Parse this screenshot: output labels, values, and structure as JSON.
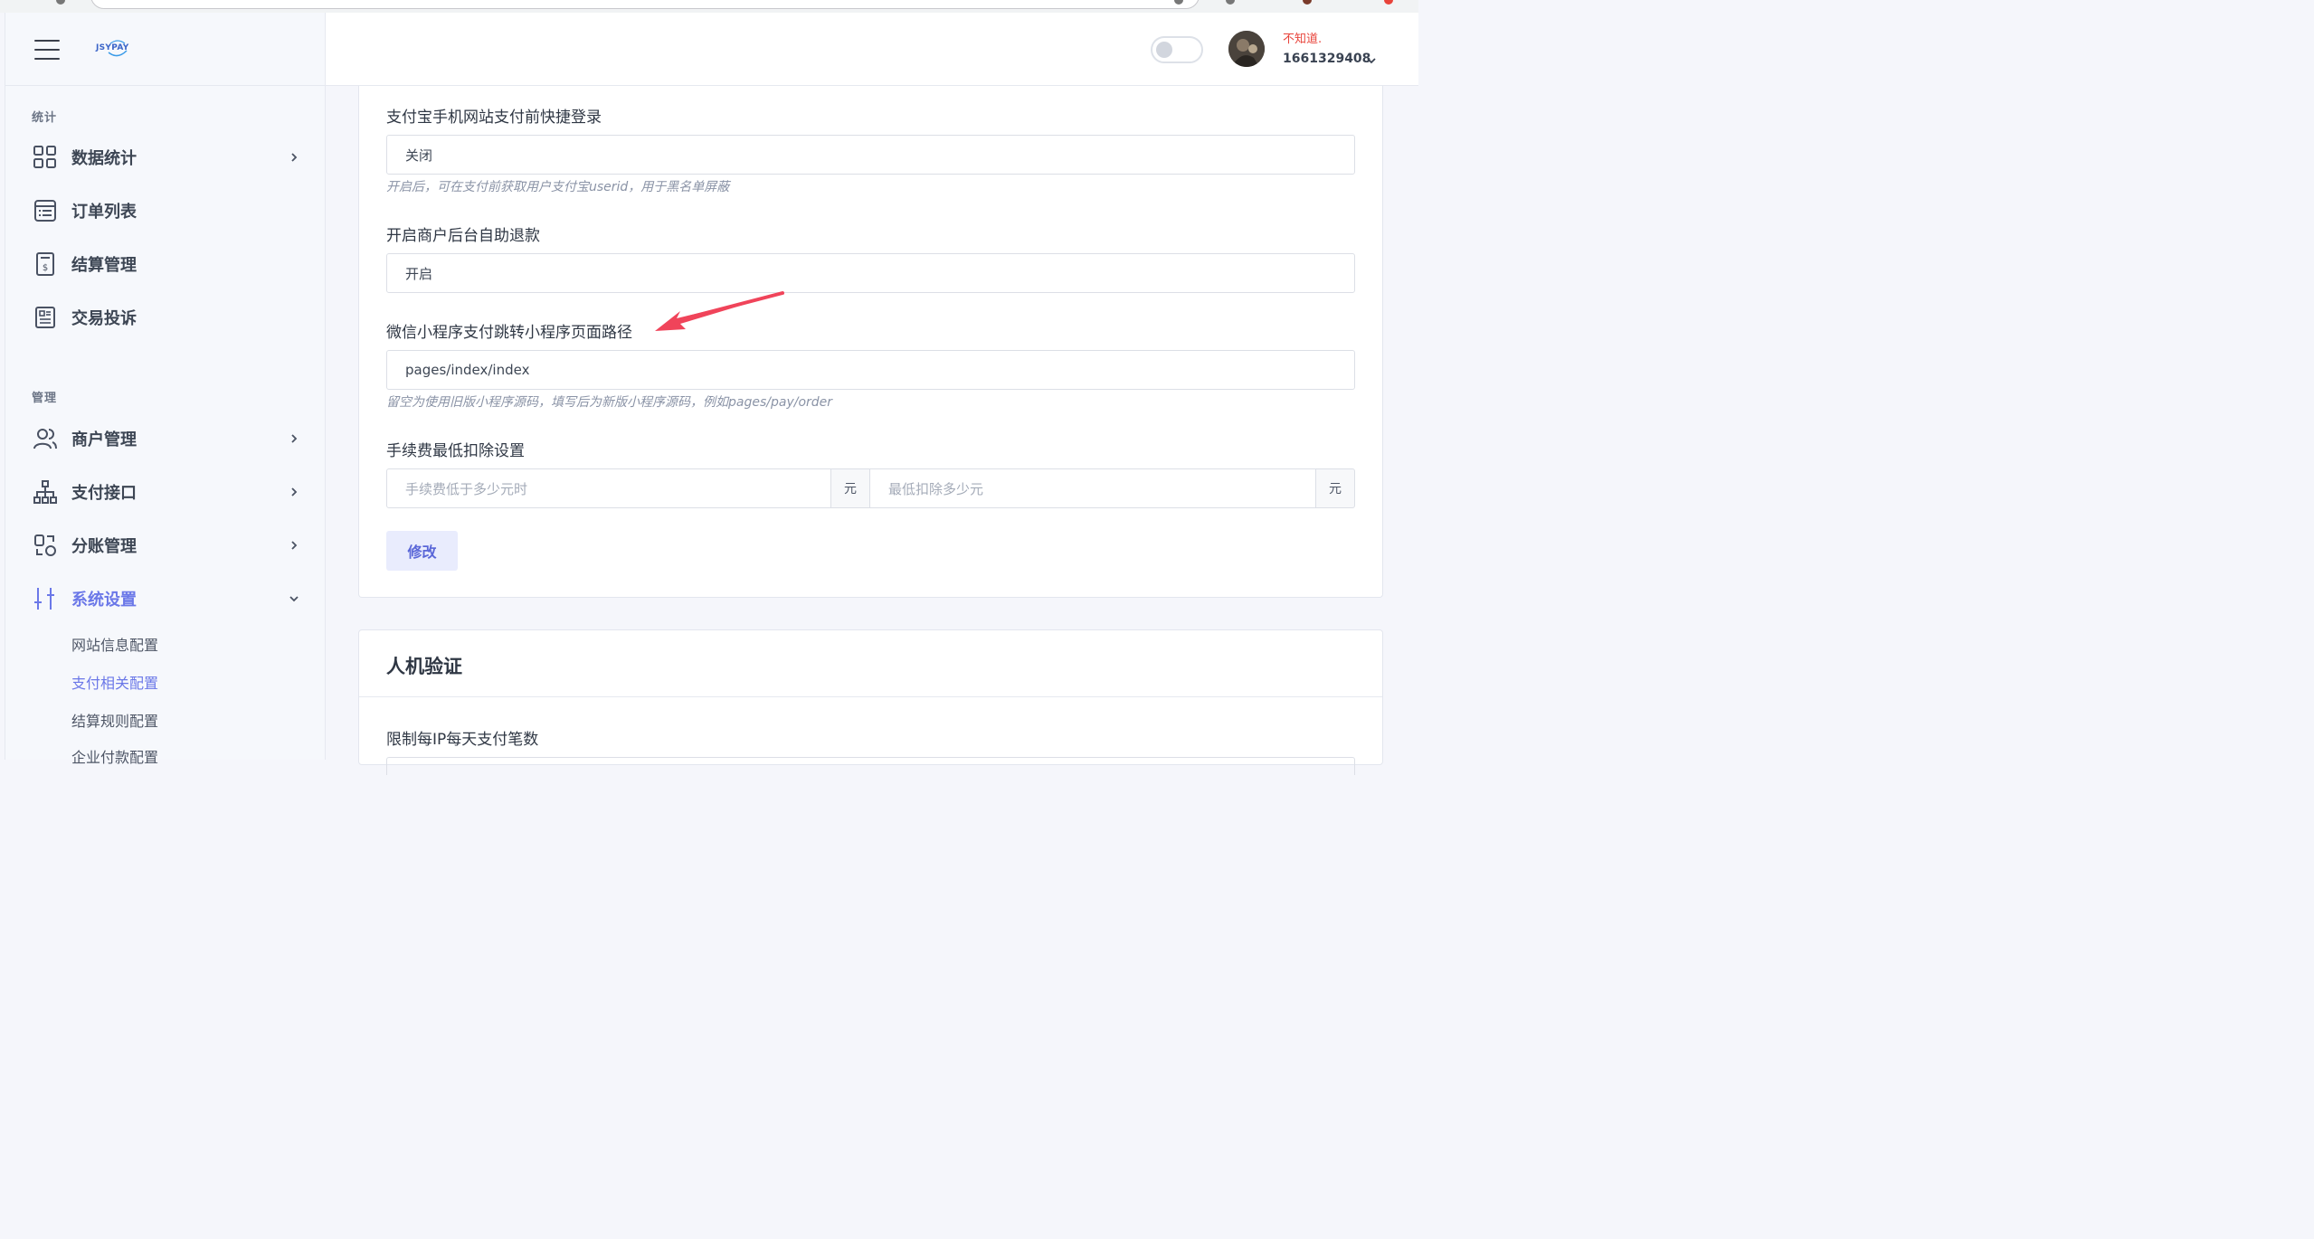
{
  "app": {
    "logo": "JSYPAY"
  },
  "sidebar": {
    "sections": [
      {
        "label": "统计"
      },
      {
        "label": "管理"
      }
    ],
    "items": [
      {
        "label": "数据统计",
        "icon": "grid-icon",
        "has_children": true
      },
      {
        "label": "订单列表",
        "icon": "list-icon",
        "has_children": false
      },
      {
        "label": "结算管理",
        "icon": "document-dollar-icon",
        "has_children": false
      },
      {
        "label": "交易投诉",
        "icon": "newspaper-icon",
        "has_children": false
      },
      {
        "label": "商户管理",
        "icon": "users-icon",
        "has_children": true
      },
      {
        "label": "支付接口",
        "icon": "sitemap-icon",
        "has_children": true
      },
      {
        "label": "分账管理",
        "icon": "split-icon",
        "has_children": true
      },
      {
        "label": "系统设置",
        "icon": "sliders-icon",
        "has_children": true,
        "expanded": true
      }
    ],
    "sub_items": [
      {
        "label": "网站信息配置"
      },
      {
        "label": "支付相关配置",
        "active": true
      },
      {
        "label": "结算规则配置"
      },
      {
        "label": "企业付款配置"
      }
    ]
  },
  "header": {
    "user_name": "不知道.",
    "user_id": "1661329408"
  },
  "form": {
    "f1": {
      "label": "支付宝手机网站支付前快捷登录",
      "value": "关闭",
      "help": "开启后，可在支付前获取用户支付宝userid，用于黑名单屏蔽"
    },
    "f2": {
      "label": "开启商户后台自助退款",
      "value": "开启"
    },
    "f3": {
      "label": "微信小程序支付跳转小程序页面路径",
      "value": "pages/index/index",
      "help": "留空为使用旧版小程序源码，填写后为新版小程序源码，例如pages/pay/order"
    },
    "f4": {
      "label": "手续费最低扣除设置",
      "placeholder1": "手续费低于多少元时",
      "addon1": "元",
      "placeholder2": "最低扣除多少元",
      "addon2": "元"
    },
    "submit": "修改"
  },
  "card2": {
    "title": "人机验证",
    "field_label": "限制每IP每天支付笔数"
  },
  "colors": {
    "accent": "#6b78e8",
    "arrow": "#f0445a",
    "user_name": "#e8433a"
  }
}
